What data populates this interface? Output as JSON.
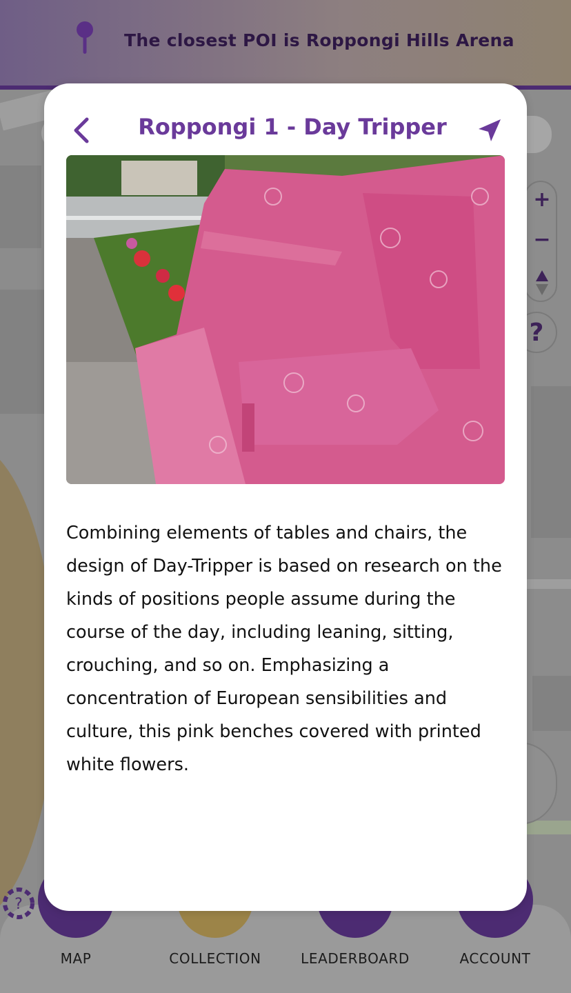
{
  "banner": {
    "text": "The closest POI is Roppongi Hills Arena"
  },
  "map_controls": {
    "zoom_in": "+",
    "zoom_out": "−",
    "help": "?"
  },
  "modal": {
    "title": "Roppongi 1 - Day Tripper",
    "description": "Combining elements of tables and chairs, the design of Day-Tripper is based on research on the kinds of positions people assume during the course of the day, including leaning, sitting, crouching, and so on. Emphasizing a concentration of European sensibilities and culture, this pink benches covered with printed white flowers.",
    "back_icon": "chevron-left-icon",
    "navigate_icon": "navigation-arrow-icon"
  },
  "bottom_nav": {
    "items": [
      {
        "label": "MAP",
        "color": "#4c2b72"
      },
      {
        "label": "COLLECTION",
        "color": "#9c8448"
      },
      {
        "label": "LEADERBOARD",
        "color": "#4c2b72"
      },
      {
        "label": "ACCOUNT",
        "color": "#4c2b72"
      }
    ]
  },
  "colors": {
    "accent": "#6a3a9a",
    "dark_purple": "#4c2b72",
    "banner_text": "#2d1744"
  }
}
